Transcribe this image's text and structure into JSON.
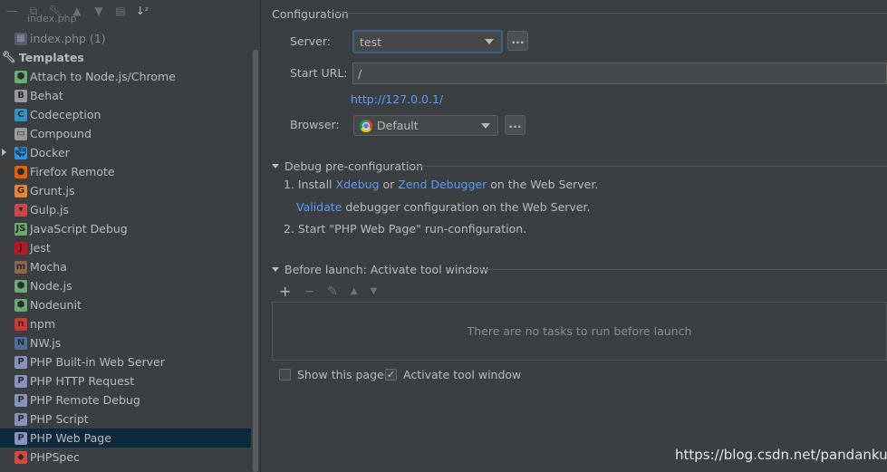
{
  "left_panel": {
    "ghost_text": "index.php",
    "recent_item": "index.php (1)",
    "templates_label": "Templates",
    "items": [
      {
        "label": "Attach to Node.js/Chrome",
        "icon": "attach-node-icon",
        "color": "#6aab73"
      },
      {
        "label": "Behat",
        "icon": "behat-icon",
        "color": "#9a9a9a"
      },
      {
        "label": "Codeception",
        "icon": "codeception-icon",
        "color": "#3592c4"
      },
      {
        "label": "Compound",
        "icon": "compound-icon",
        "color": "#9a9a9a"
      },
      {
        "label": "Docker",
        "icon": "docker-icon",
        "color": "#2496ed"
      },
      {
        "label": "Firefox Remote",
        "icon": "firefox-icon",
        "color": "#e66000"
      },
      {
        "label": "Grunt.js",
        "icon": "grunt-icon",
        "color": "#e48632"
      },
      {
        "label": "Gulp.js",
        "icon": "gulp-icon",
        "color": "#cf4647"
      },
      {
        "label": "JavaScript Debug",
        "icon": "javascript-debug-icon",
        "color": "#6aab73"
      },
      {
        "label": "Jest",
        "icon": "jest-icon",
        "color": "#c21325"
      },
      {
        "label": "Mocha",
        "icon": "mocha-icon",
        "color": "#8d6748"
      },
      {
        "label": "Node.js",
        "icon": "nodejs-icon",
        "color": "#6aab73"
      },
      {
        "label": "Nodeunit",
        "icon": "nodeunit-icon",
        "color": "#6aab73"
      },
      {
        "label": "npm",
        "icon": "npm-icon",
        "color": "#cb3837"
      },
      {
        "label": "NW.js",
        "icon": "nwjs-icon",
        "color": "#4b6f9e"
      },
      {
        "label": "PHP Built-in Web Server",
        "icon": "php-server-icon",
        "color": "#8892bf"
      },
      {
        "label": "PHP HTTP Request",
        "icon": "php-http-icon",
        "color": "#8892bf"
      },
      {
        "label": "PHP Remote Debug",
        "icon": "php-remote-debug-icon",
        "color": "#8892bf"
      },
      {
        "label": "PHP Script",
        "icon": "php-script-icon",
        "color": "#8892bf"
      },
      {
        "label": "PHP Web Page",
        "icon": "php-web-page-icon",
        "color": "#8892bf"
      },
      {
        "label": "PHPSpec",
        "icon": "phpspec-icon",
        "color": "#d64c3c"
      }
    ]
  },
  "config": {
    "title": "Configuration",
    "server_label": "Server:",
    "server_value": "test",
    "start_url_label": "Start URL:",
    "start_url_value": "/",
    "resolved_url": "http://127.0.0.1/",
    "browser_label": "Browser:",
    "browser_value": "Default",
    "dots": "..."
  },
  "debug": {
    "title": "Debug pre-configuration",
    "step1_prefix": "1. Install",
    "xdebug": "Xdebug",
    "or": "or",
    "zend": "Zend Debugger",
    "step1_suffix": "on the Web Server.",
    "validate": "Validate",
    "validate_suffix": "debugger configuration on the Web Server.",
    "step2": "2. Start \"PHP Web Page\" run-configuration."
  },
  "before_launch": {
    "title": "Before launch: Activate tool window",
    "empty_text": "There are no tasks to run before launch",
    "show_page": "Show this page",
    "activate": "Activate tool window",
    "show_page_checked": false,
    "activate_checked": true
  },
  "watermark": "https://blog.csdn.net/pandankun"
}
